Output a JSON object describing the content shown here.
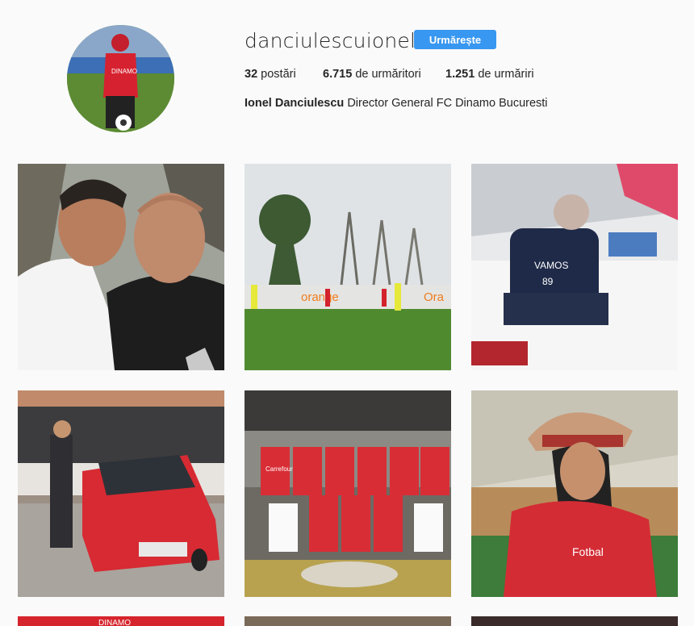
{
  "profile": {
    "username": "danciulescuionel",
    "follow_label": "Urmărește",
    "posts_count": "32",
    "posts_label": "postări",
    "followers_count": "6.715",
    "followers_label": "de urmăritori",
    "following_count": "1.251",
    "following_label": "de urmăriri",
    "full_name": "Ionel Danciulescu",
    "bio_text": "Director General FC Dinamo Bucuresti",
    "avatar_icon": "profile-photo"
  },
  "photo_text": {
    "dinamo_jersey": "DINAMO",
    "banner_orange": "orange",
    "banner_orange_2": "Ora",
    "shirt_vamos": "VAMOS",
    "shirt_number": "89",
    "jersey_sponsor": "Carrefour",
    "scarf_text": "Fotbal",
    "bottom_dinamo": "DINAMO"
  },
  "colors": {
    "accent": "#3897f0",
    "dinamo_red": "#d31f26"
  }
}
